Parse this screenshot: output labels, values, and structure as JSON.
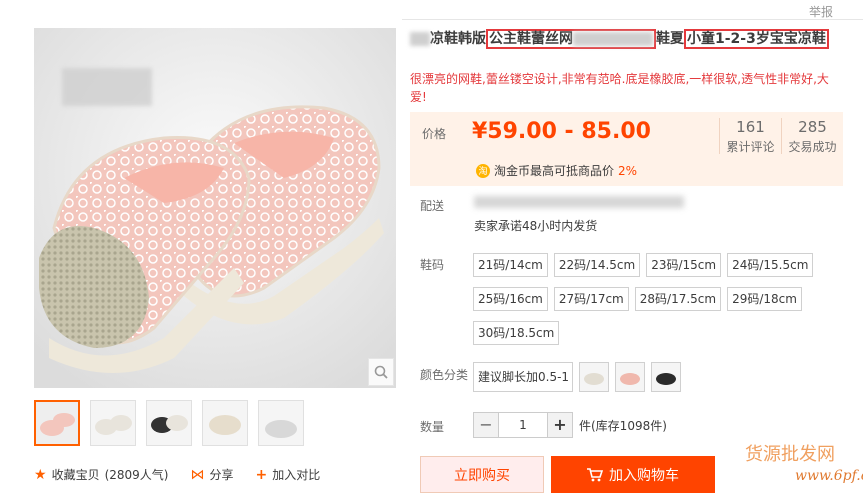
{
  "report": "举报",
  "title": {
    "part1": "凉鞋韩版",
    "highlight1": "公主鞋蕾丝网",
    "part2": "鞋夏",
    "highlight2": "小童1-2-3岁宝宝凉鞋"
  },
  "subtitle": "很漂亮的网鞋,蕾丝镂空设计,非常有范哈.底是橡胶底,一样很软,透气性非常好,大爱!",
  "price": {
    "label": "价格",
    "value": "¥59.00 - 85.00",
    "reviews_count": "161",
    "reviews_label": "累计评论",
    "sales_count": "285",
    "sales_label": "交易成功",
    "coin_text": "淘金币最高可抵商品价",
    "coin_pct": "2%",
    "coin_icon": "淘"
  },
  "delivery": {
    "label": "配送",
    "promise": "卖家承诺48小时内发货"
  },
  "size": {
    "label": "鞋码",
    "options": [
      "21码/14cm",
      "22码/14.5cm",
      "23码/15cm",
      "24码/15.5cm",
      "25码/16cm",
      "27码/17cm",
      "28码/17.5cm",
      "29码/18cm",
      "30码/18.5cm"
    ]
  },
  "color": {
    "label": "颜色分类",
    "text_option": "建议脚长加0.5-1"
  },
  "quantity": {
    "label": "数量",
    "value": "1",
    "minus": "−",
    "plus": "+",
    "stock": "件(库存1098件)"
  },
  "buttons": {
    "buy": "立即购买",
    "cart": "加入购物车"
  },
  "actions": {
    "favorite": "收藏宝贝",
    "favorite_count": "(2809人气)",
    "share": "分享",
    "compare": "加入对比"
  },
  "watermark": {
    "line1": "货源批发网",
    "line2": "www.6pf.cn"
  }
}
